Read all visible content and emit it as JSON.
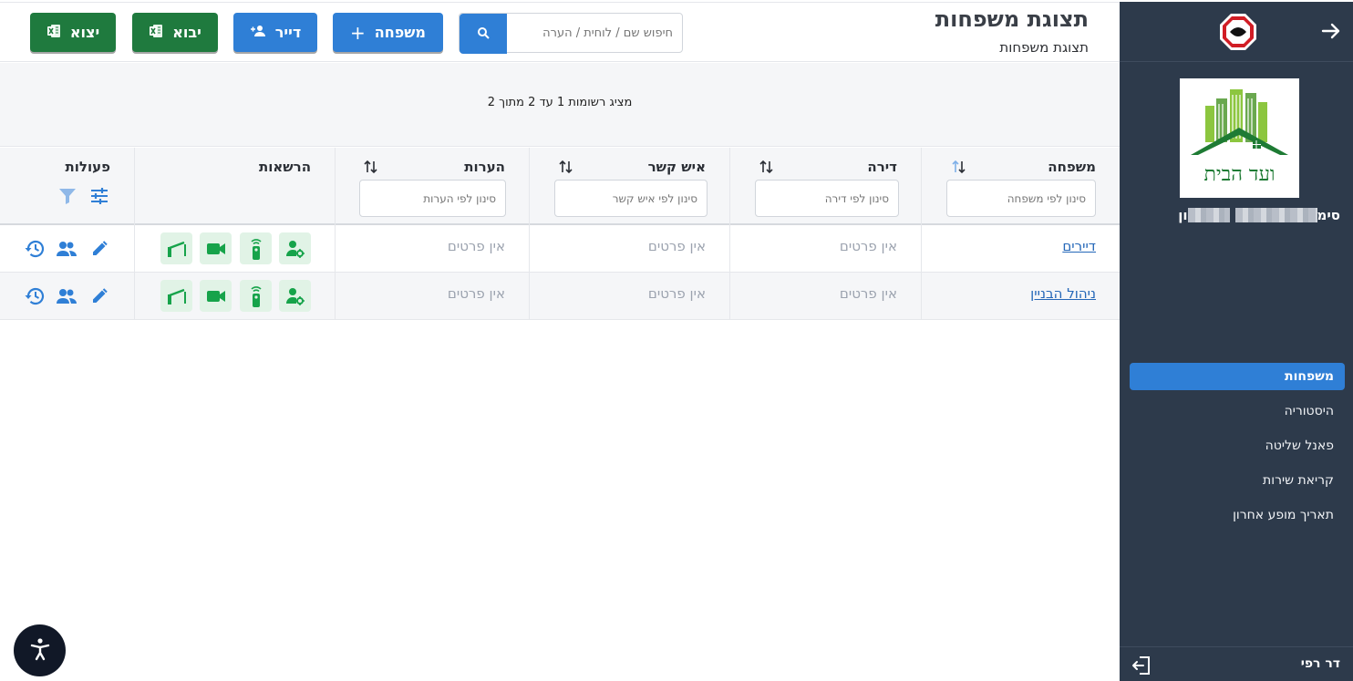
{
  "sidebar": {
    "user_name_start": "סימ",
    "user_name_end": "ון",
    "nav": [
      {
        "label": "משפחות",
        "active": true
      },
      {
        "label": "היסטוריה",
        "active": false
      },
      {
        "label": "פאנל שליטה",
        "active": false
      },
      {
        "label": "קריאת שירות",
        "active": false
      },
      {
        "label": "תאריך מופע אחרון",
        "active": false
      }
    ],
    "logo_text": "ועד הבית",
    "footer_name": "דר רפי"
  },
  "header": {
    "title": "תצוגת משפחות",
    "breadcrumb": "תצוגת משפחות"
  },
  "toolbar": {
    "export_label": "יצוא",
    "import_label": "יבוא",
    "tenant_label": "דייר",
    "family_label": "משפחה",
    "search_placeholder": "חיפוש שם / לוחית / הערה"
  },
  "records_info": "מציג רשומות 1 עד 2 מתוך 2",
  "table": {
    "columns": {
      "family": "משפחה",
      "apartment": "דירה",
      "contact": "איש קשר",
      "notes": "הערות",
      "permissions": "הרשאות",
      "actions": "פעולות"
    },
    "filters": {
      "family": "סינון לפי משפחה",
      "apartment": "סינון לפי דירה",
      "contact": "סינון לפי איש קשר",
      "notes": "סינון לפי הערות"
    },
    "rows": [
      {
        "family": "דיירים",
        "apartment": "אין פרטים",
        "contact": "אין פרטים",
        "notes": "אין פרטים"
      },
      {
        "family": "ניהול הבניין",
        "apartment": "אין פרטים",
        "contact": "אין פרטים",
        "notes": "אין פרטים"
      }
    ]
  },
  "colors": {
    "sidebar_bg": "#2d3a4b",
    "accent_blue": "#2f7fd6",
    "excel_green": "#1f7a3e",
    "permission_green": "#16a34a"
  }
}
